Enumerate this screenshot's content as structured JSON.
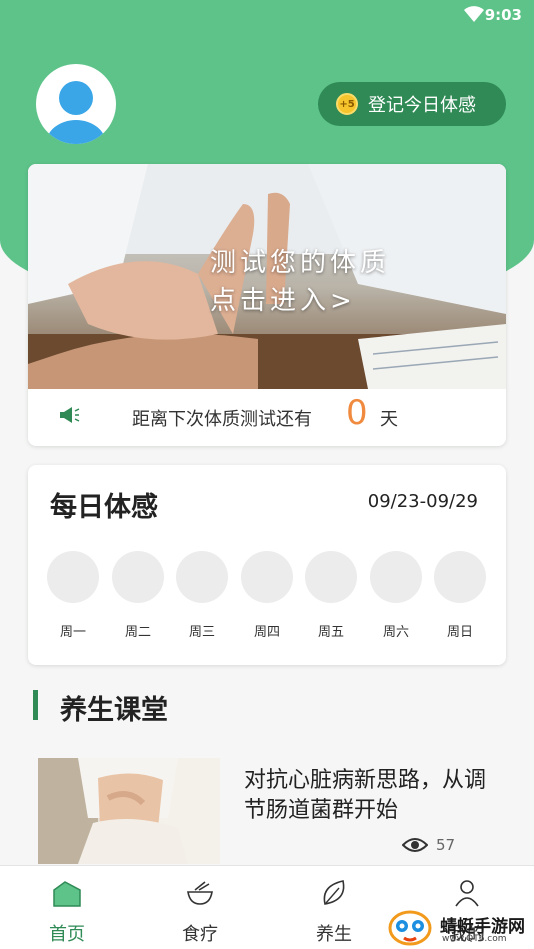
{
  "status_bar": {
    "time": "9:03"
  },
  "checkin": {
    "badge": "+5",
    "label": "登记今日体感"
  },
  "test_card": {
    "banner_line1": "测试您的体质",
    "banner_line2": "点击进入>",
    "countdown_label": "距离下次体质测试还有",
    "countdown_value": "0",
    "countdown_unit": "天"
  },
  "daily": {
    "title": "每日体感",
    "range": "09/23-09/29",
    "days": [
      "周一",
      "周二",
      "周三",
      "周四",
      "周五",
      "周六",
      "周日"
    ]
  },
  "section": {
    "title": "养生课堂"
  },
  "article": {
    "title": "对抗心脏病新思路，从调节肠道菌群开始",
    "views": "57"
  },
  "tabbar": {
    "tabs": [
      {
        "label": "首页",
        "icon": "home-icon",
        "active": true
      },
      {
        "label": "食疗",
        "icon": "bowl-icon",
        "active": false
      },
      {
        "label": "养生",
        "icon": "leaf-icon",
        "active": false
      },
      {
        "label": "我的",
        "icon": "user-icon",
        "active": false
      }
    ]
  },
  "watermark": {
    "text": "蜻蜓手游网",
    "sub": "www.QT6.com"
  },
  "colors": {
    "primary": "#5dc389",
    "dark_green": "#2f8a55",
    "accent": "#f08a3e"
  }
}
